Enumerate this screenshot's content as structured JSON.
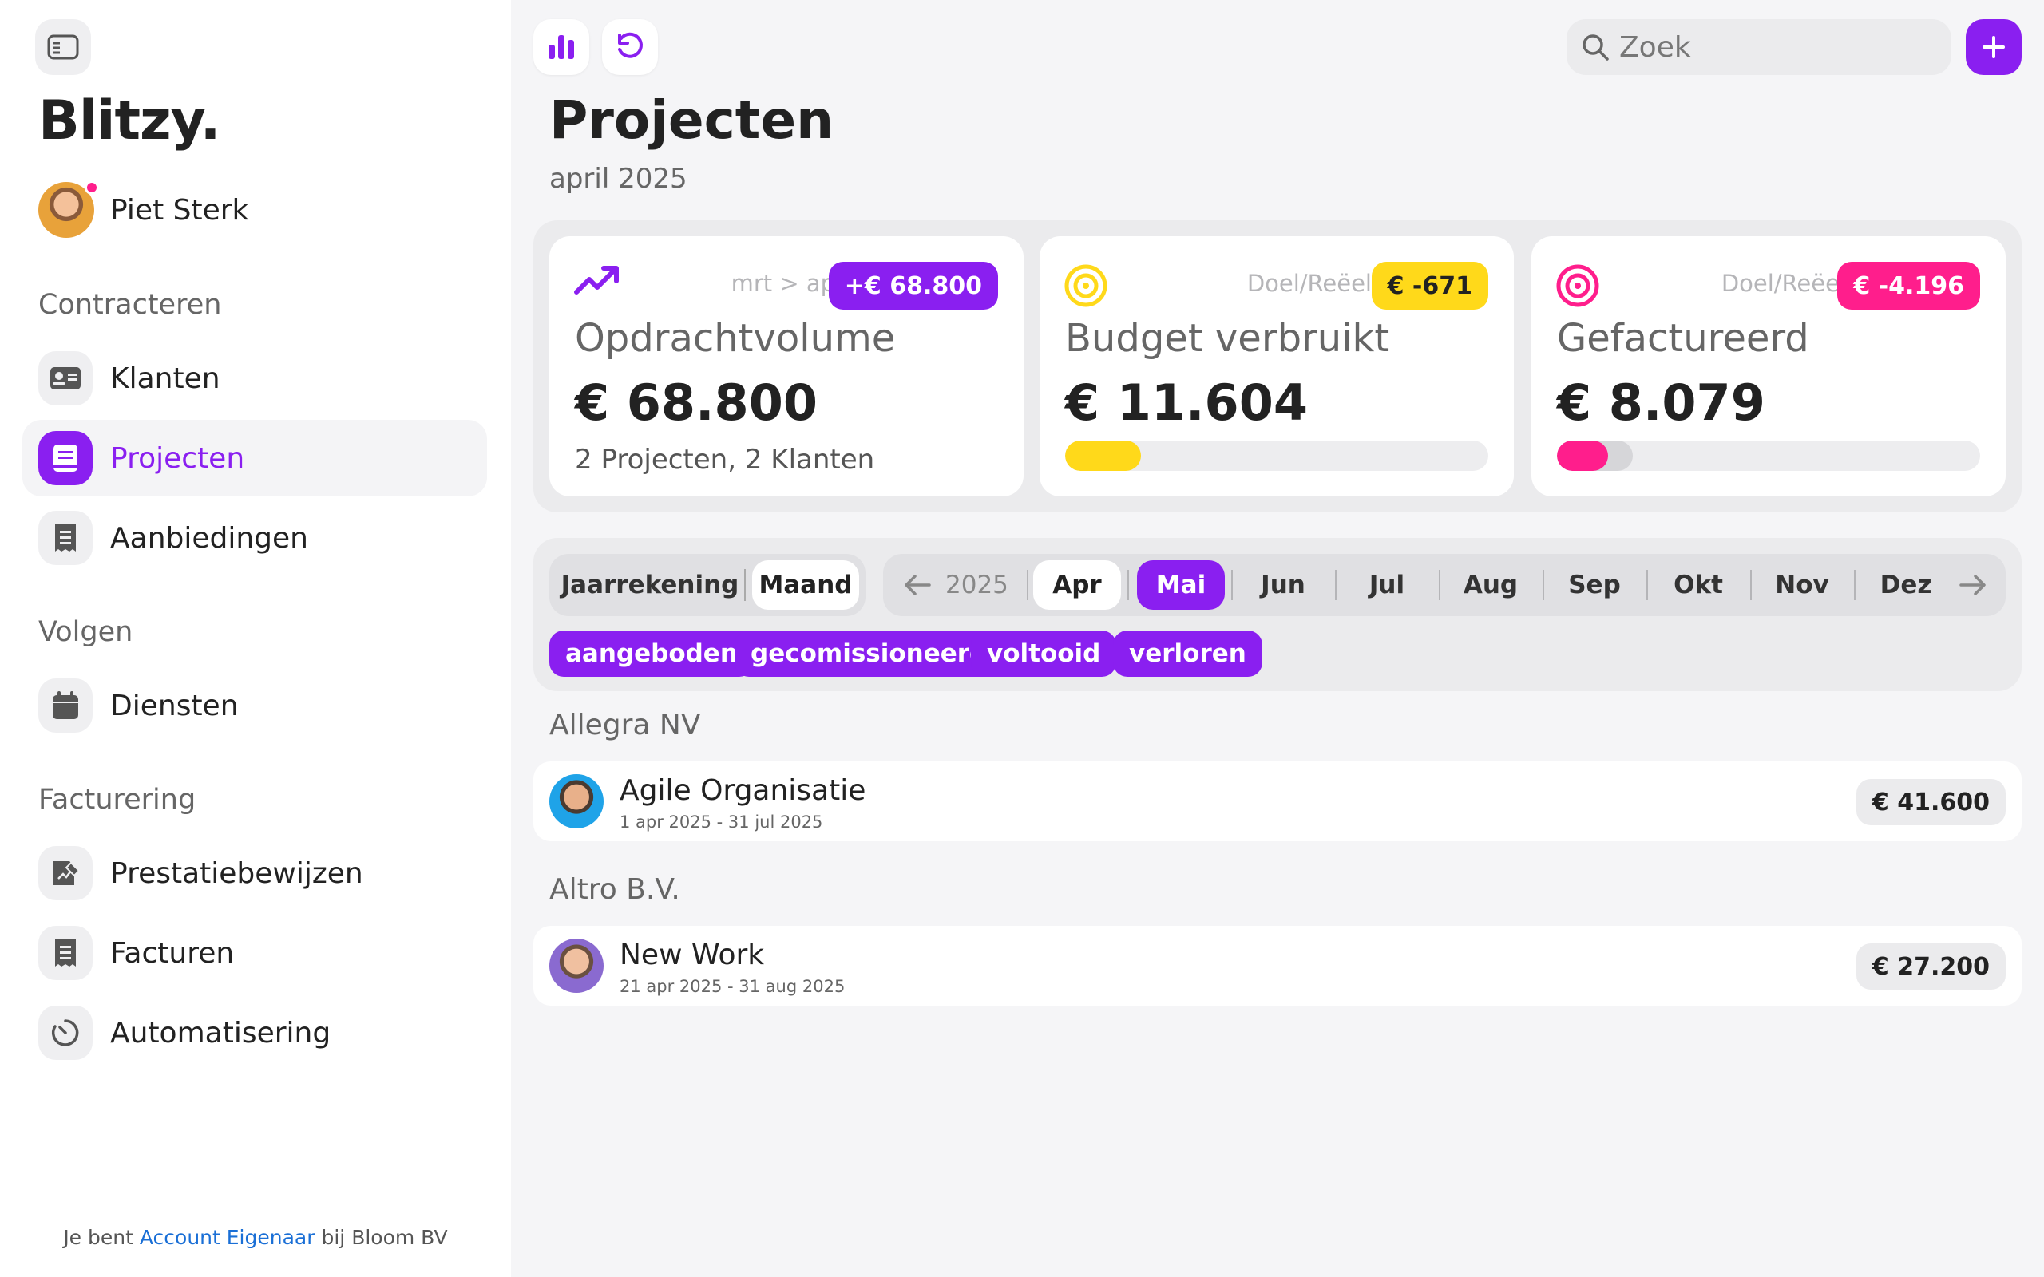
{
  "sidebar": {
    "logo": "Blitzy.",
    "user_name": "Piet Sterk",
    "sections": {
      "contracteren": "Contracteren",
      "volgen": "Volgen",
      "facturering": "Facturering"
    },
    "items": {
      "klanten": "Klanten",
      "projecten": "Projecten",
      "aanbiedingen": "Aanbiedingen",
      "diensten": "Diensten",
      "prestatiebewijzen": "Prestatiebewijzen",
      "facturen": "Facturen",
      "automatisering": "Automatisering"
    },
    "footer": {
      "prefix": "Je bent",
      "link": "Account Eigenaar",
      "suffix": "bij Bloom BV"
    }
  },
  "topbar": {
    "search_placeholder": "Zoek"
  },
  "header": {
    "title": "Projecten",
    "subtitle": "april 2025"
  },
  "cards": [
    {
      "meta": "mrt > apr",
      "badge": "+€ 68.800",
      "title": "Opdrachtvolume",
      "value": "€ 68.800",
      "sub": "2 Projecten, 2 Klanten"
    },
    {
      "meta": "Doel/Reëel",
      "badge": "€ -671",
      "title": "Budget verbruikt",
      "value": "€ 11.604",
      "progress": 0.18
    },
    {
      "meta": "Doel/Reëel",
      "badge": "€ -4.196",
      "title": "Gefactureerd",
      "value": "€ 8.079",
      "progress": 0.12,
      "progress_secondary": 0.18
    }
  ],
  "colors": {
    "accent": "#8a1ff0",
    "yellow": "#ffd91a",
    "pink": "#ff1e8c"
  },
  "filters": {
    "view": [
      "Jaarrekening",
      "Maand"
    ],
    "year": "2025",
    "months": [
      "Apr",
      "Mai",
      "Jun",
      "Jul",
      "Aug",
      "Sep",
      "Okt",
      "Nov",
      "Dez"
    ],
    "tags": [
      "aangeboden",
      "gecomissioneerd",
      "voltooid",
      "verloren"
    ]
  },
  "groups": [
    {
      "client": "Allegra NV",
      "project": "Agile Organisatie",
      "dates": "1 apr 2025 - 31 jul 2025",
      "amount": "€ 41.600"
    },
    {
      "client": "Altro B.V.",
      "project": "New Work",
      "dates": "21 apr 2025 - 31 aug 2025",
      "amount": "€ 27.200"
    }
  ]
}
